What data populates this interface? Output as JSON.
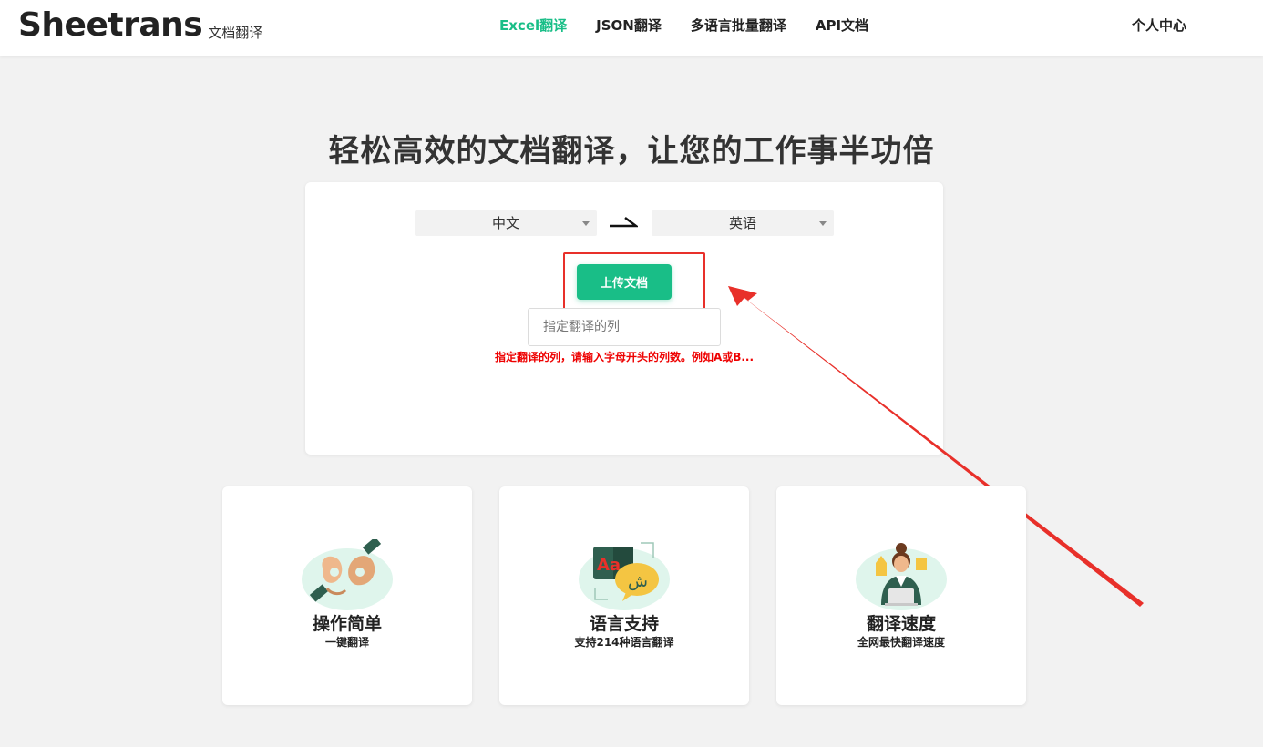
{
  "brand": {
    "name": "Sheetrans",
    "subtitle": "文档翻译"
  },
  "nav": {
    "items": [
      {
        "label": "Excel翻译",
        "active": true
      },
      {
        "label": "JSON翻译",
        "active": false
      },
      {
        "label": "多语言批量翻译",
        "active": false
      },
      {
        "label": "API文档",
        "active": false
      }
    ],
    "user_center": "个人中心"
  },
  "headline": "轻松高效的文档翻译，让您的工作事半功倍",
  "translator": {
    "source_language": "中文",
    "target_language": "英语",
    "upload_label": "上传文档",
    "column_placeholder": "指定翻译的列",
    "column_value": "",
    "hint": "指定翻译的列，请输入字母开头的列数。例如A或B..."
  },
  "features": [
    {
      "title": "操作简单",
      "desc": "一键翻译",
      "icon": "ok-hand-gesture-icon"
    },
    {
      "title": "语言支持",
      "desc": "支持214种语言翻译",
      "icon": "translate-bubbles-icon"
    },
    {
      "title": "翻译速度",
      "desc": "全网最快翻译速度",
      "icon": "translator-person-icon"
    }
  ],
  "colors": {
    "accent": "#19be87",
    "highlight": "#e8302a",
    "hint": "#ee0000",
    "background": "#f2f2f2"
  }
}
